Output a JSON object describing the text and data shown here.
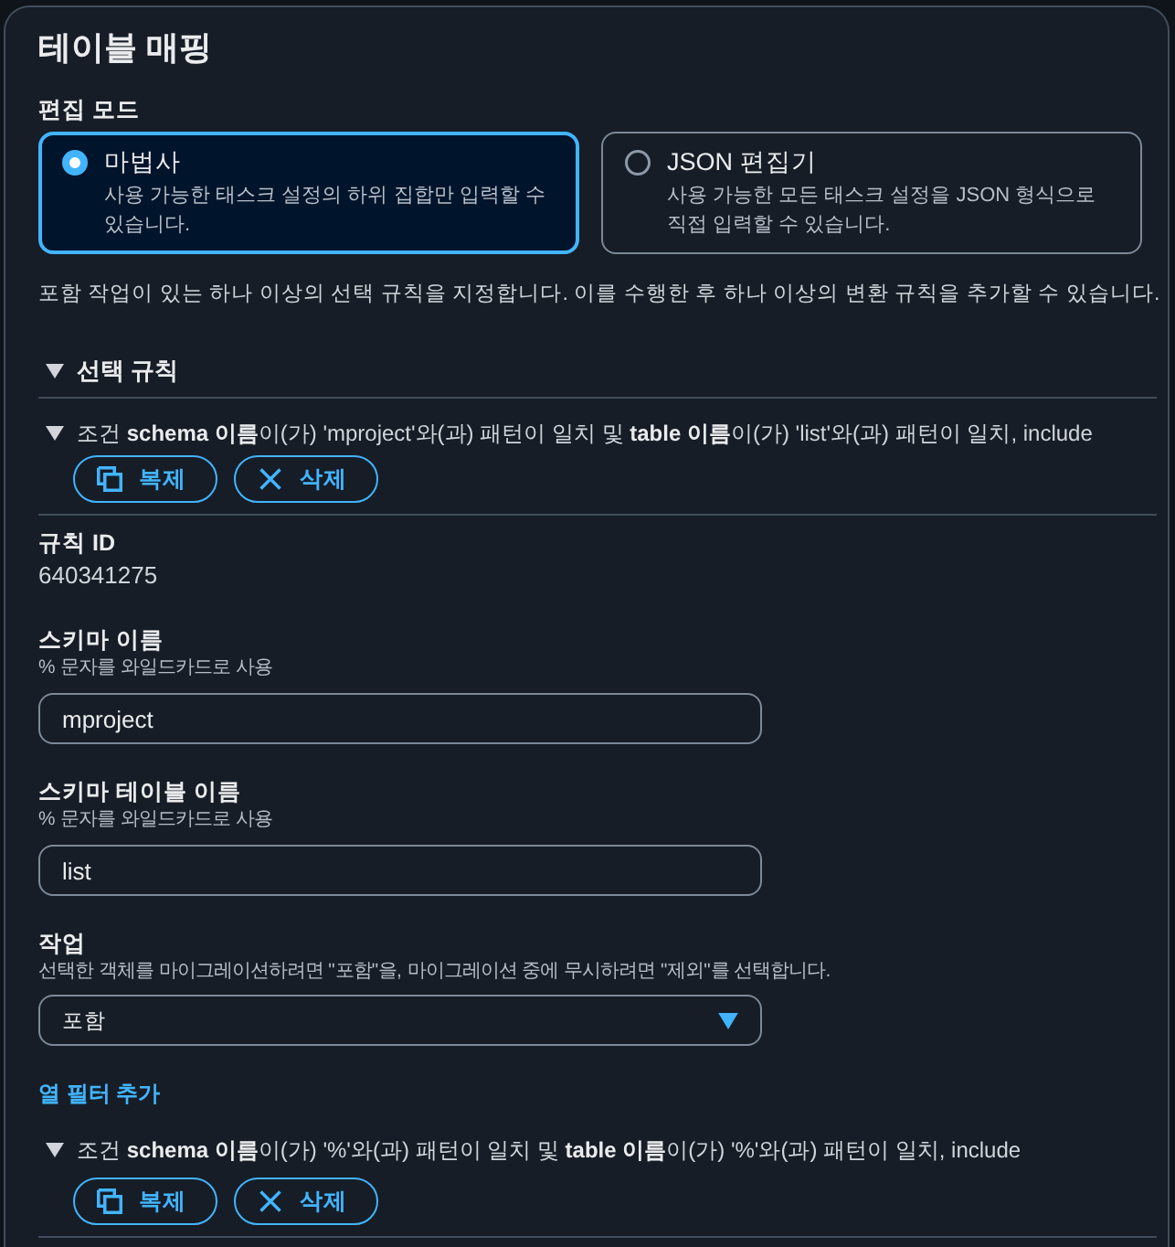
{
  "panel": {
    "title": "테이블 매핑"
  },
  "edit_mode": {
    "label": "편집 모드",
    "options": [
      {
        "title": "마법사",
        "description": "사용 가능한 태스크 설정의 하위 집합만 입력할 수 있습니다.",
        "selected": true
      },
      {
        "title": "JSON 편집기",
        "description": "사용 가능한 모든 태스크 설정을 JSON 형식으로 직접 입력할 수 있습니다.",
        "selected": false
      }
    ]
  },
  "intro": "포함 작업이 있는 하나 이상의 선택 규칙을 지정합니다. 이를 수행한 후 하나 이상의 변환 규칙을 추가할 수 있습니다.",
  "selection_rules": {
    "title": "선택 규칙",
    "expanded": true,
    "rules": [
      {
        "summary": "조건 **schema 이름**이(가) 'mproject'와(과) 패턴이 일치 및 **table 이름**이(가) 'list'와(과) 패턴이 일치, include",
        "expanded": true,
        "buttons": [
          {
            "kind": "copy",
            "label": "복제"
          },
          {
            "kind": "delete",
            "label": "삭제"
          }
        ],
        "fields": [
          {
            "kind": "static",
            "label": "규칙 ID",
            "value": "640341275"
          },
          {
            "kind": "text",
            "label": "스키마 이름",
            "hint": "% 문자를 와일드카드로 사용",
            "value": "mproject"
          },
          {
            "kind": "text",
            "label": "스키마 테이블 이름",
            "hint": "% 문자를 와일드카드로 사용",
            "value": "list"
          },
          {
            "kind": "select",
            "label": "작업",
            "hint": "선택한 객체를 마이그레이션하려면 \"포함\"을, 마이그레이션 중에 무시하려면 \"제외\"를 선택합니다.",
            "value": "포함"
          }
        ],
        "add_filter_link": "열 필터 추가"
      },
      {
        "summary": "조건 **schema 이름**이(가) '%'와(과) 패턴이 일치 및 **table 이름**이(가) '%'와(과) 패턴이 일치, include",
        "expanded": true,
        "buttons": [
          {
            "kind": "copy",
            "label": "복제"
          },
          {
            "kind": "delete",
            "label": "삭제"
          }
        ]
      }
    ]
  }
}
